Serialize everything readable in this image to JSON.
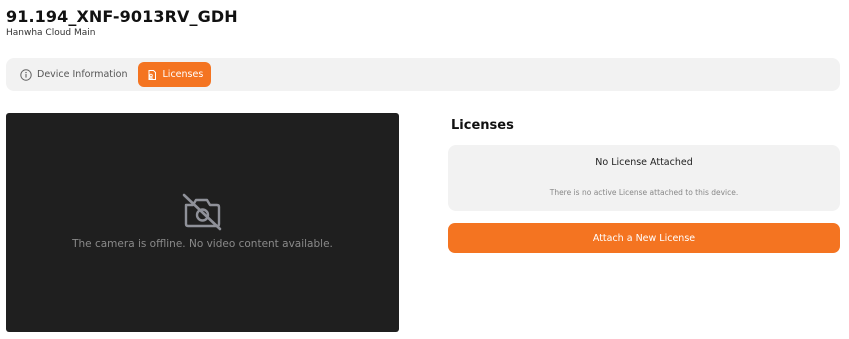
{
  "header": {
    "device_name": "91.194_XNF-9013RV_GDH",
    "location": "Hanwha Cloud Main"
  },
  "tabs": [
    {
      "label": "Device Information",
      "icon": "info-circle-icon",
      "active": false
    },
    {
      "label": "Licenses",
      "icon": "license-icon",
      "active": true
    }
  ],
  "video": {
    "offline_message": "The camera is offline. No video content available.",
    "icon": "camera-off-icon"
  },
  "licenses": {
    "heading": "Licenses",
    "card_title": "No License Attached",
    "card_description": "There is no active License attached to this device.",
    "attach_button_label": "Attach a New License"
  },
  "colors": {
    "accent": "#f47421",
    "video_background": "#1f1f1f",
    "card_background": "#f2f2f2"
  }
}
